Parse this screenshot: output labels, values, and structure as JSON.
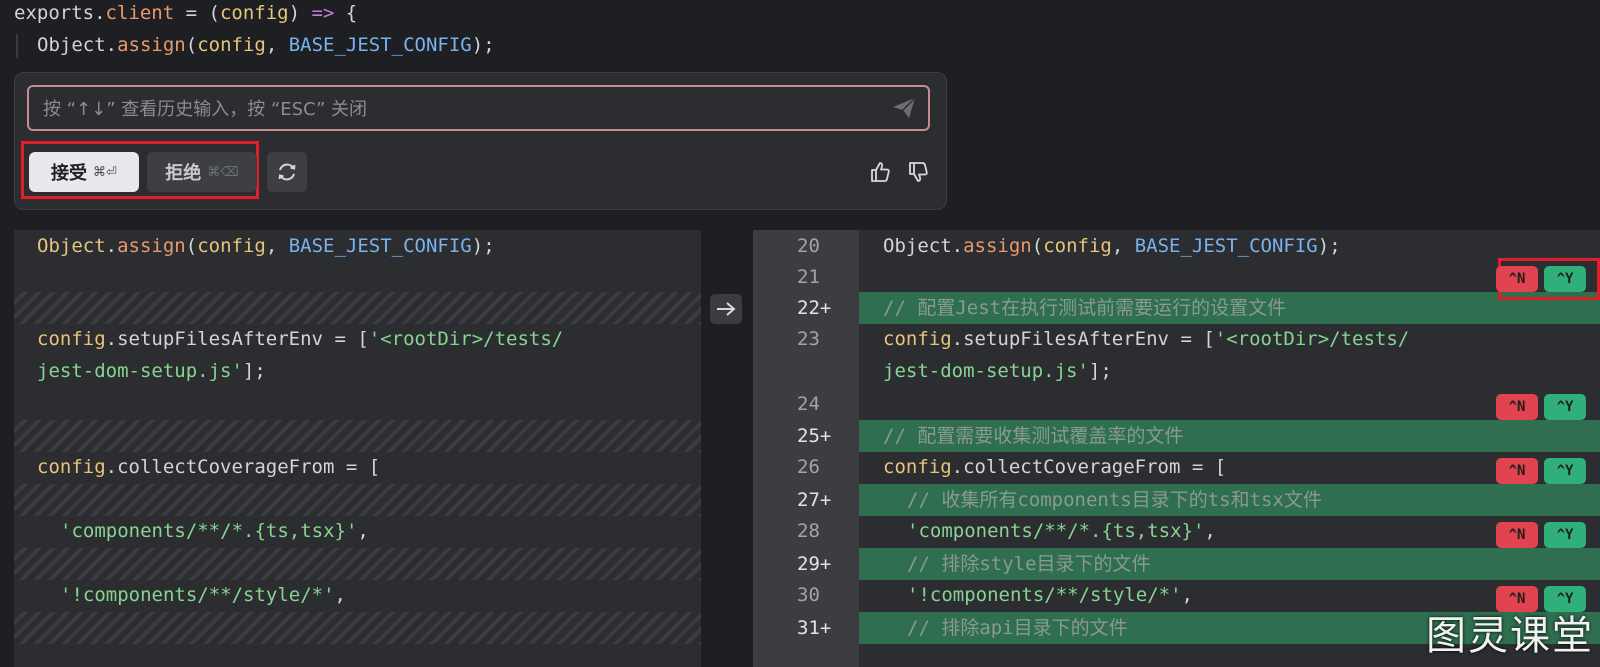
{
  "top_editor": {
    "line1": {
      "obj": "exports",
      "dot": ".",
      "prop": "client",
      "rest1": " = (",
      "param": "config",
      "rest2": ") ",
      "arrow": "=>",
      "rest3": " {"
    },
    "line2": {
      "obj": "Object",
      "dot": ".",
      "method": "assign",
      "open": "(",
      "arg1": "config",
      "comma": ", ",
      "arg2": "BASE_JEST_CONFIG",
      "close": ");"
    }
  },
  "ai_panel": {
    "prompt_placeholder": "按 “↑↓” 查看历史输入，按 “ESC” 关闭",
    "accept_label": "接受",
    "accept_shortcut": "⌘⏎",
    "reject_label": "拒绝",
    "reject_shortcut": "⌘⌫"
  },
  "icons": [
    "send-icon",
    "refresh-icon",
    "thumb-up-icon",
    "thumb-down-icon",
    "swap-arrow-icon"
  ],
  "left_pane": {
    "line_assign": {
      "obj": "Object",
      "dot": ".",
      "method": "assign",
      "open": "(",
      "arg1": "config",
      "comma": ", ",
      "arg2": "BASE_JEST_CONFIG",
      "close": ");"
    },
    "line_setup_a": {
      "obj": "config",
      "dot": ".",
      "prop": "setupFilesAfterEnv",
      "eq": " = [",
      "str": "'<rootDir>/tests/"
    },
    "line_setup_b": {
      "str": "jest-dom-setup.js'",
      "close": "];"
    },
    "line_collect": {
      "obj": "config",
      "dot": ".",
      "prop": "collectCoverageFrom",
      "eq": " = ["
    },
    "line_comp": {
      "str": "'components/**/*.{ts,tsx}'",
      "comma": ","
    },
    "line_style": {
      "str": "'!components/**/style/*'",
      "comma": ","
    }
  },
  "right_pane": {
    "line_numbers": [
      "20",
      "21",
      "22+",
      "23",
      "24",
      "25+",
      "26",
      "27+",
      "28",
      "29+",
      "30",
      "31+"
    ],
    "line_assign": {
      "obj": "Object",
      "dot": ".",
      "method": "assign",
      "open": "(",
      "arg1": "config",
      "comma": ", ",
      "arg2": "BASE_JEST_CONFIG",
      "close": ");"
    },
    "comment_22": "// 配置Jest在执行测试前需要运行的设置文件",
    "line_setup_a": {
      "obj": "config",
      "dot": ".",
      "prop": "setupFilesAfterEnv",
      "eq": " = [",
      "str": "'<rootDir>/tests/"
    },
    "line_setup_b": {
      "str": "jest-dom-setup.js'",
      "close": "];"
    },
    "comment_25": "// 配置需要收集测试覆盖率的文件",
    "line_collect": {
      "obj": "config",
      "dot": ".",
      "prop": "collectCoverageFrom",
      "eq": " = ["
    },
    "comment_27": "// 收集所有components目录下的ts和tsx文件",
    "line_comp": {
      "str": "'components/**/*.{ts,tsx}'",
      "comma": ","
    },
    "comment_29": "// 排除style目录下的文件",
    "line_style": {
      "str": "'!components/**/style/*'",
      "comma": ","
    },
    "comment_31": "// 排除api目录下的文件",
    "reject_badge": "^N",
    "accept_badge": "^Y"
  },
  "watermark": "图灵课堂"
}
